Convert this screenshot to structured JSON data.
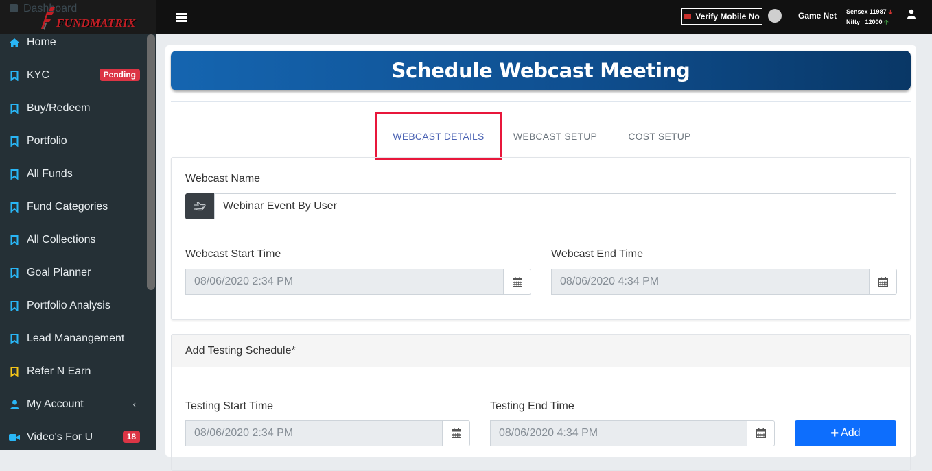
{
  "sidebar": {
    "ghost_item": "Dashboard",
    "logo_text": "FUNDMATRIX",
    "items": [
      {
        "label": "Home",
        "icon": "home-icon"
      },
      {
        "label": "KYC",
        "icon": "bookmark-icon",
        "badge": "Pending"
      },
      {
        "label": "Buy/Redeem",
        "icon": "bookmark-icon"
      },
      {
        "label": "Portfolio",
        "icon": "bookmark-icon"
      },
      {
        "label": "All Funds",
        "icon": "bookmark-icon"
      },
      {
        "label": "Fund Categories",
        "icon": "bookmark-icon"
      },
      {
        "label": "All Collections",
        "icon": "bookmark-icon"
      },
      {
        "label": "Goal Planner",
        "icon": "bookmark-icon"
      },
      {
        "label": "Portfolio Analysis",
        "icon": "bookmark-icon"
      },
      {
        "label": "Lead Manangement",
        "icon": "bookmark-icon"
      },
      {
        "label": "Refer N Earn",
        "icon": "bookmark-icon"
      },
      {
        "label": "My Account",
        "icon": "user-icon"
      },
      {
        "label": "Video's For U",
        "icon": "video-icon",
        "badge": "18"
      }
    ]
  },
  "topbar": {
    "verify_label": "Verify Mobile No",
    "user_name": "Game Net",
    "sensex_label": "Sensex",
    "sensex_value": "11987",
    "nifty_label": "Nifty",
    "nifty_value": "12000"
  },
  "page": {
    "title": "Schedule Webcast Meeting",
    "tabs": [
      "WEBCAST DETAILS",
      "WEBCAST SETUP",
      "COST SETUP"
    ],
    "active_tab": 0
  },
  "form": {
    "webcast_name_label": "Webcast Name",
    "webcast_name_value": "Webinar Event By User",
    "start_label": "Webcast Start Time",
    "start_value": "08/06/2020 2:34 PM",
    "end_label": "Webcast End Time",
    "end_value": "08/06/2020 4:34 PM"
  },
  "testing": {
    "header": "Add Testing Schedule*",
    "start_label": "Testing Start Time",
    "start_value": "08/06/2020 2:34 PM",
    "end_label": "Testing End Time",
    "end_value": "08/06/2020 4:34 PM",
    "add_label": "Add"
  },
  "colors": {
    "sidebar_bg": "#253036",
    "accent_cyan": "#29b6f6",
    "accent_yellow": "#f5c518",
    "banner_blue": "#0f4f90",
    "primary_button": "#0d6efd",
    "badge_red": "#dc3545",
    "active_tab_border": "#e8173b"
  }
}
